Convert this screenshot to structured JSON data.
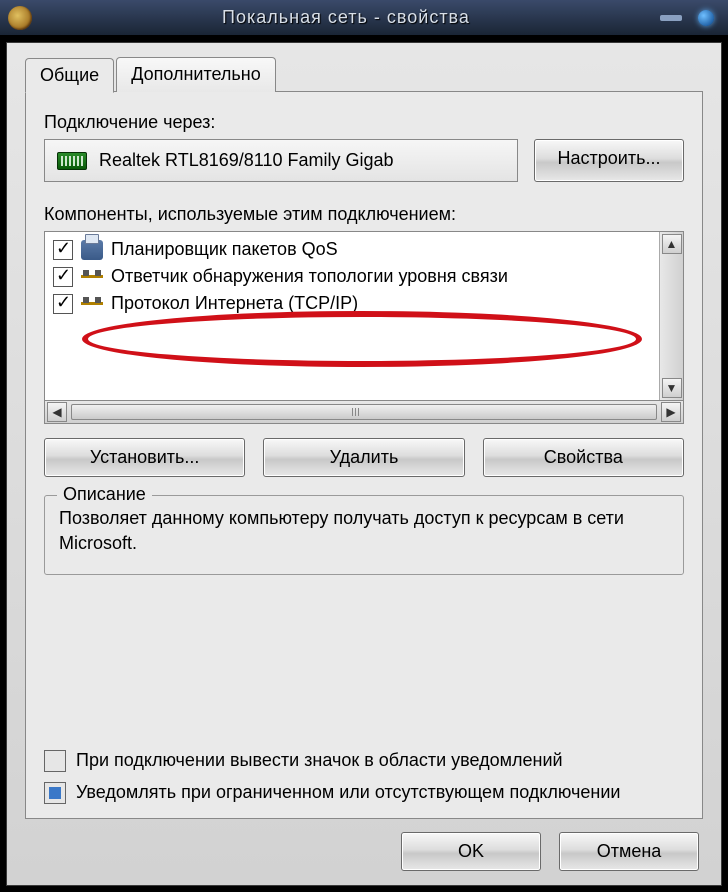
{
  "title": "Покальная сеть - свойства",
  "tabs": {
    "general": "Общие",
    "advanced": "Дополнительно"
  },
  "connect_label": "Подключение через:",
  "adapter_name": "Realtek RTL8169/8110 Family Gigab",
  "configure_btn": "Настроить...",
  "components_label": "Компоненты, используемые этим подключением:",
  "components": [
    {
      "label": "Планировщик пакетов QoS",
      "icon": "printer"
    },
    {
      "label": "Ответчик обнаружения топологии уровня связи",
      "icon": "net"
    },
    {
      "label": "Протокол Интернета (TCP/IP)",
      "icon": "net"
    }
  ],
  "install_btn": "Установить...",
  "remove_btn": "Удалить",
  "props_btn": "Свойства",
  "desc_legend": "Описание",
  "desc_text": "Позволяет данному компьютеру получать доступ к ресурсам в сети Microsoft.",
  "cb_show_icon": "При подключении вывести значок в области уведомлений",
  "cb_notify": "Уведомлять при ограниченном или отсутствующем подключении",
  "ok_btn": "OK",
  "cancel_btn": "Отмена"
}
